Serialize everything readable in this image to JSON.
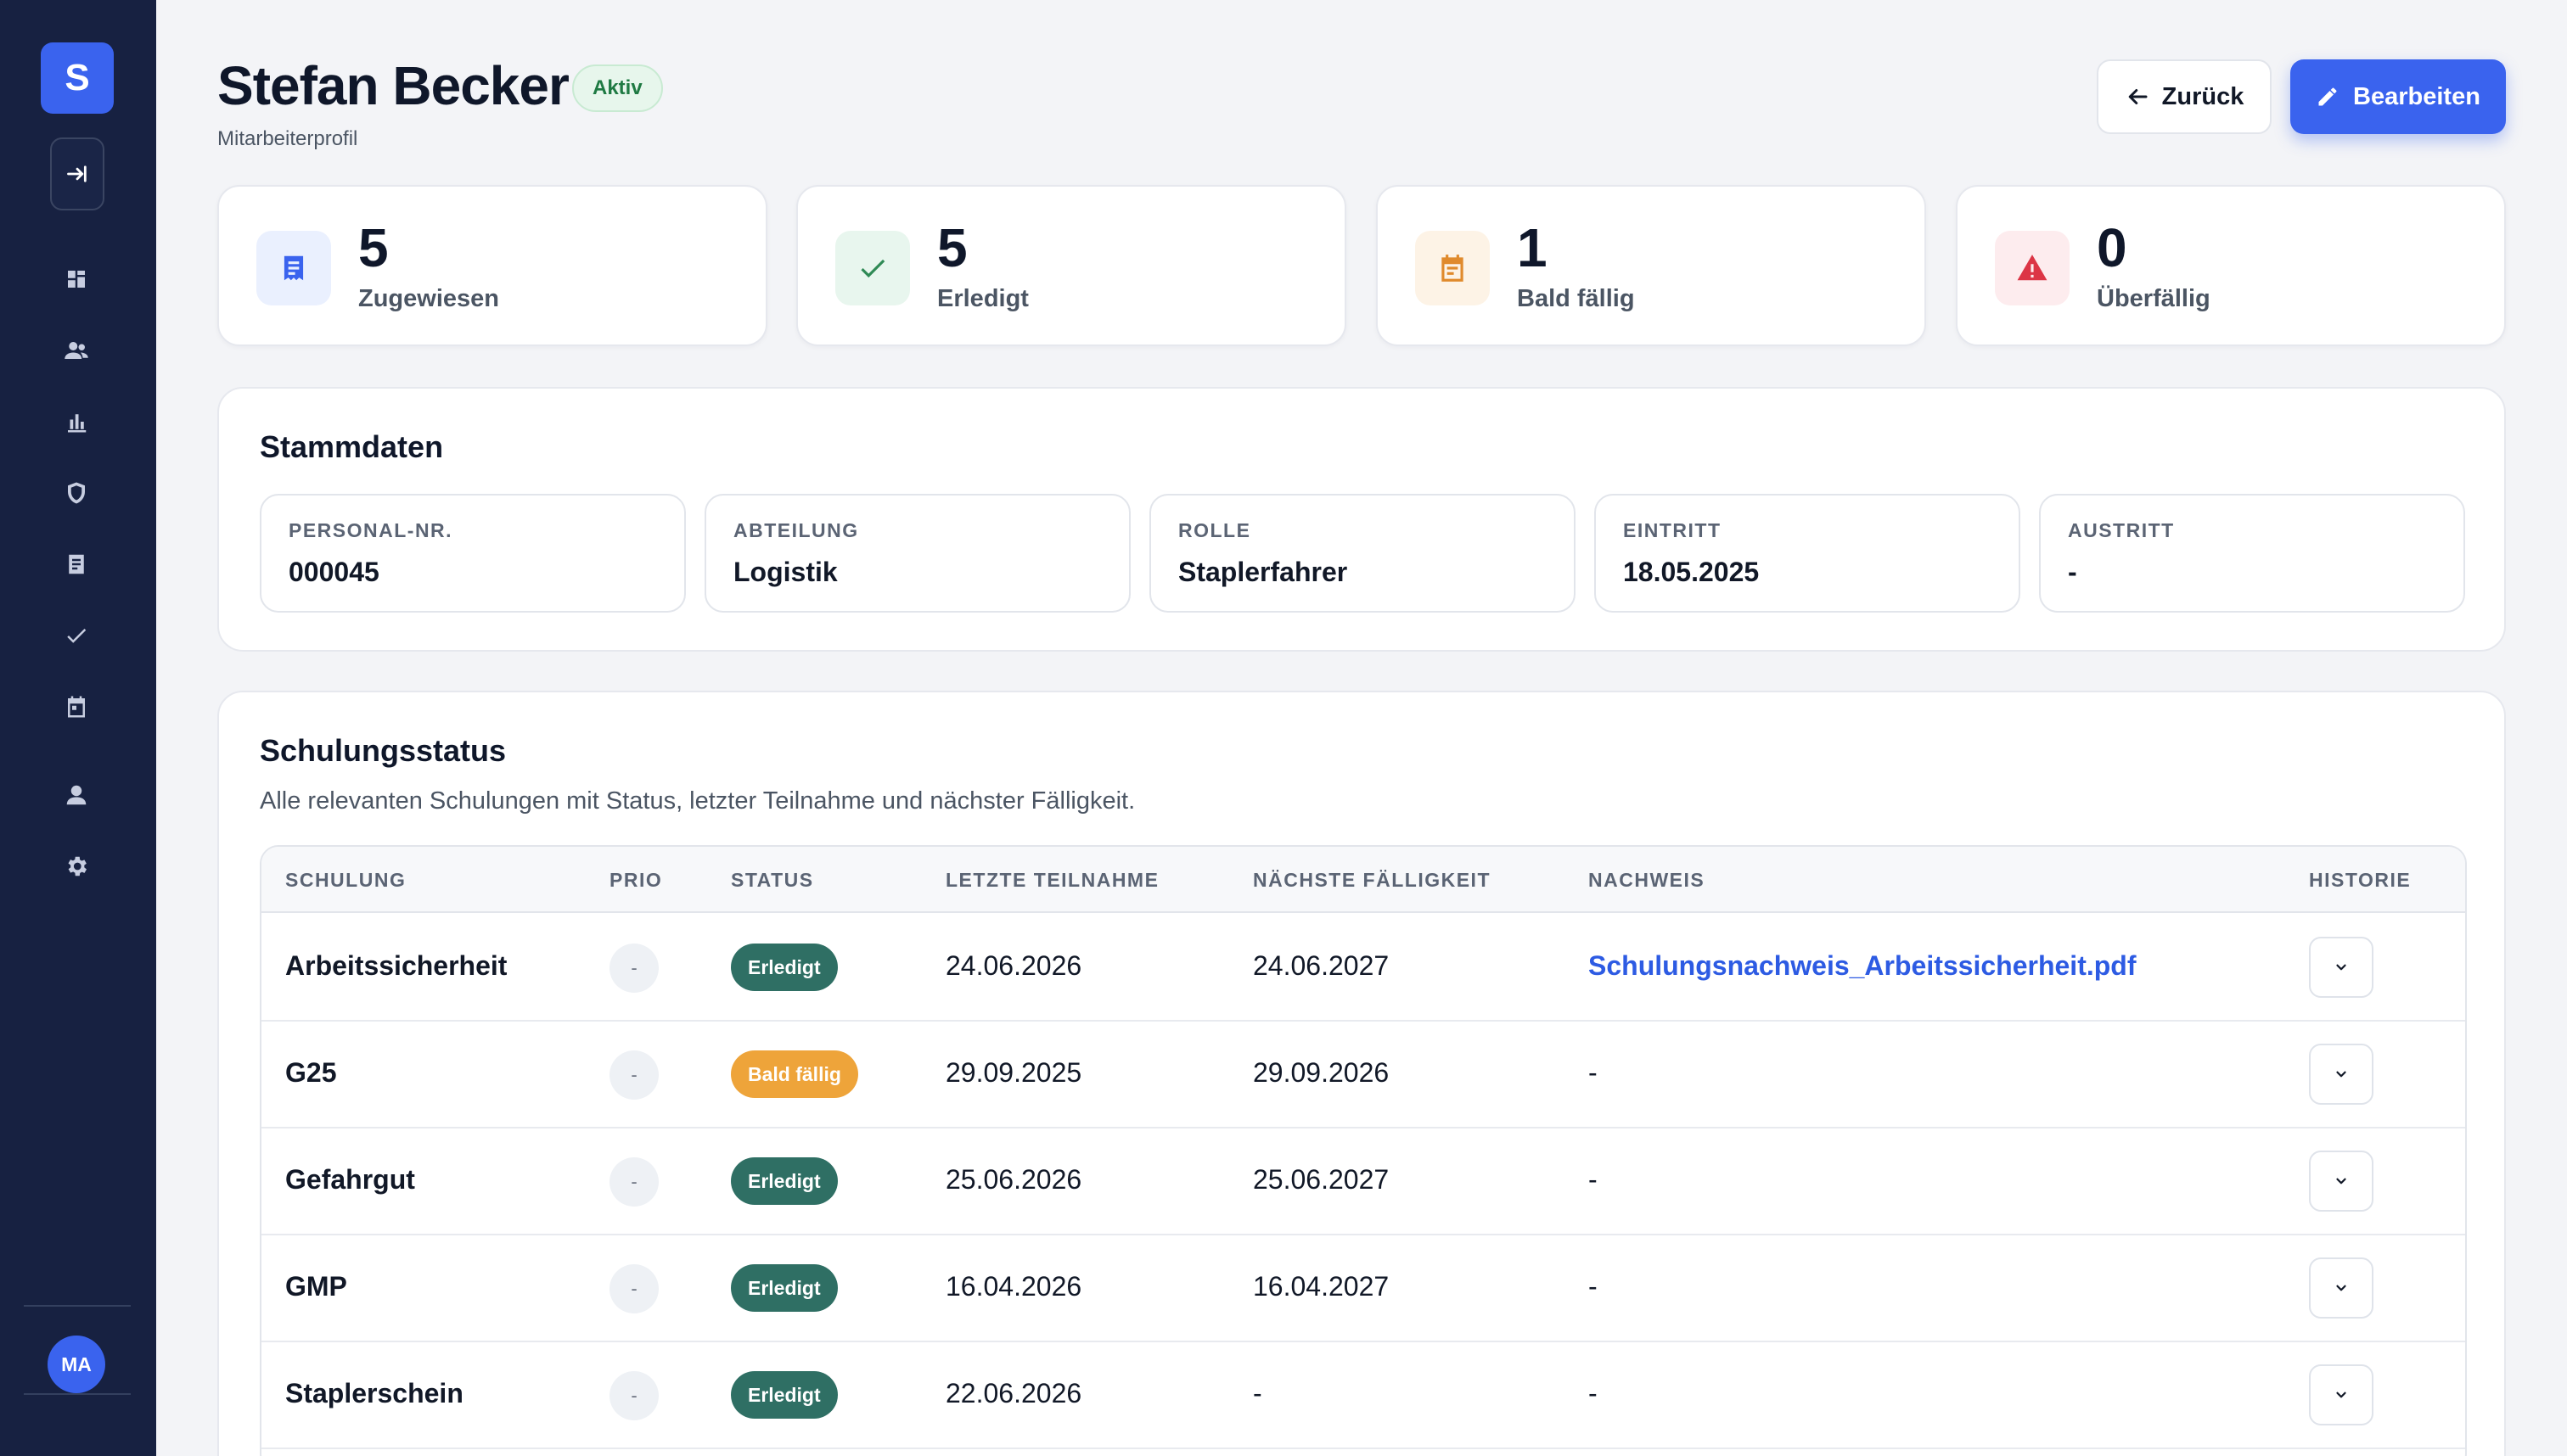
{
  "sidebar": {
    "logo_letter": "S",
    "nav_icons": [
      "collapse-icon",
      "dashboard-icon",
      "users-icon",
      "chart-icon",
      "shield-icon",
      "document-icon",
      "check-icon",
      "calendar-icon",
      "person-icon",
      "gear-icon"
    ],
    "avatar_initials": "MA"
  },
  "header": {
    "title": "Stefan Becker",
    "status_badge": "Aktiv",
    "subtitle": "Mitarbeiterprofil",
    "back_label": "Zurück",
    "edit_label": "Bearbeiten"
  },
  "stats": [
    {
      "value": "5",
      "label": "Zugewiesen",
      "icon": "document-icon",
      "color": "#3a63ee"
    },
    {
      "value": "5",
      "label": "Erledigt",
      "icon": "check-icon",
      "color": "#2f8a55"
    },
    {
      "value": "1",
      "label": "Bald fällig",
      "icon": "calendar-icon",
      "color": "#e08a2c"
    },
    {
      "value": "0",
      "label": "Überfällig",
      "icon": "warning-icon",
      "color": "#dc3545"
    }
  ],
  "stammdaten": {
    "title": "Stammdaten",
    "fields": [
      {
        "label": "PERSONAL-NR.",
        "value": "000045"
      },
      {
        "label": "ABTEILUNG",
        "value": "Logistik"
      },
      {
        "label": "ROLLE",
        "value": "Staplerfahrer"
      },
      {
        "label": "EINTRITT",
        "value": "18.05.2025"
      },
      {
        "label": "AUSTRITT",
        "value": "-"
      }
    ]
  },
  "schulungsstatus": {
    "title": "Schulungsstatus",
    "description": "Alle relevanten Schulungen mit Status, letzter Teilnahme und nächster Fälligkeit.",
    "columns": [
      "SCHULUNG",
      "PRIO",
      "STATUS",
      "LETZTE TEILNAHME",
      "NÄCHSTE FÄLLIGKEIT",
      "NACHWEIS",
      "HISTORIE"
    ],
    "rows": [
      {
        "name": "Arbeitssicherheit",
        "prio": "-",
        "status": "Erledigt",
        "status_color": "#2f6f64",
        "last": "24.06.2026",
        "next": "24.06.2027",
        "proof": "Schulungsnachweis_Arbeitssicherheit.pdf",
        "proof_is_link": true
      },
      {
        "name": "G25",
        "prio": "-",
        "status": "Bald fällig",
        "status_color": "#eea43a",
        "last": "29.09.2025",
        "next": "29.09.2026",
        "proof": "-",
        "proof_is_link": false
      },
      {
        "name": "Gefahrgut",
        "prio": "-",
        "status": "Erledigt",
        "status_color": "#2f6f64",
        "last": "25.06.2026",
        "next": "25.06.2027",
        "proof": "-",
        "proof_is_link": false
      },
      {
        "name": "GMP",
        "prio": "-",
        "status": "Erledigt",
        "status_color": "#2f6f64",
        "last": "16.04.2026",
        "next": "16.04.2027",
        "proof": "-",
        "proof_is_link": false
      },
      {
        "name": "Staplerschein",
        "prio": "-",
        "status": "Erledigt",
        "status_color": "#2f6f64",
        "last": "22.06.2026",
        "next": "-",
        "proof": "-",
        "proof_is_link": false
      }
    ]
  }
}
